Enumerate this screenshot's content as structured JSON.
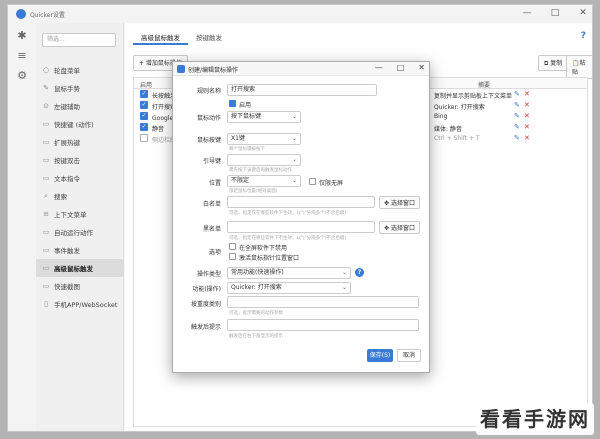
{
  "window": {
    "title": "Quicker设置"
  },
  "sidebar": {
    "search_placeholder": "筛选...",
    "items": [
      {
        "label": "轮盘菜单",
        "icon": "○"
      },
      {
        "label": "鼠标手势",
        "icon": "✎"
      },
      {
        "label": "左键辅助",
        "icon": "⊙"
      },
      {
        "label": "快捷键 (动作)",
        "icon": "▭"
      },
      {
        "label": "扩展热键",
        "icon": "▭"
      },
      {
        "label": "按键双击",
        "icon": "▭"
      },
      {
        "label": "文本指令",
        "icon": "▭"
      },
      {
        "label": "搜索",
        "icon": "⌕"
      },
      {
        "label": "上下文菜单",
        "icon": "≡"
      },
      {
        "label": "自动运行动作",
        "icon": "▭"
      },
      {
        "label": "事件触发",
        "icon": "▭"
      },
      {
        "label": "高级鼠标触发",
        "icon": "▭"
      },
      {
        "label": "快速截图",
        "icon": "▭"
      },
      {
        "label": "手机APP/WebSocket",
        "icon": "▯"
      }
    ]
  },
  "tabs": [
    {
      "label": "高级鼠标触发"
    },
    {
      "label": "按键触发"
    }
  ],
  "toolbar": {
    "add_label": "+ 增加鼠标操作",
    "copy_label": "复制",
    "paste_label": "粘贴",
    "help": "?"
  },
  "table": {
    "col_enabled": "启用",
    "col_summary": "摘要",
    "rows": [
      {
        "name": "长按触发",
        "summary": "复制并显示剪贴板上下文菜单",
        "enabled": true
      },
      {
        "name": "打开搜索",
        "summary": "Quicker: 打开搜索",
        "enabled": true
      },
      {
        "name": "Google搜",
        "summary": "Bing",
        "enabled": true
      },
      {
        "name": "静音",
        "summary": "媒体: 静音",
        "enabled": true
      },
      {
        "name": "侧边栏图",
        "summary": "Ctrl + Shift + T",
        "enabled": false
      }
    ]
  },
  "dialog": {
    "title": "创建/编辑鼠标操作",
    "rule_name_label": "规则名称",
    "rule_name_value": "打开搜索",
    "enabled_label": "启用",
    "mouse_action_label": "鼠标动作",
    "mouse_action_value": "按下鼠标键",
    "mouse_button_label": "鼠标按键",
    "mouse_button_value": "X1键",
    "mouse_button_hint": "哪个鼠标键被按下",
    "trigger_key_label": "引导键",
    "trigger_key_value": "",
    "trigger_key_hint": "需先按下该键后再触发鼠标动作",
    "position_label": "位置",
    "position_value": "不限定",
    "boundary_label": "仅限无屏",
    "position_hint": "限定鼠标位置(相对桌面)",
    "whitelist_label": "白名单",
    "whitelist_hint": "可选，指定仅在哪些软件下生效，以\"|\"分隔多个(不含后缀)",
    "blacklist_label": "黑名单",
    "blacklist_hint": "可选，指定在哪些软件下不生效，以\"|\"分隔多个(不含后缀)",
    "pick_window_label": "选择窗口",
    "options_label": "选项",
    "opt_fullscreen": "在全屏软件下禁用",
    "opt_cursor": "激活鼠标指针位置窗口",
    "op_type_label": "操作类型",
    "op_type_value": "常用功能(快速操作)",
    "function_label": "功能(操作)",
    "function_value": "Quicker: 打开搜索",
    "params_label": "按重度类别",
    "params_hint": "可选，提示需要的动作参数",
    "post_trigger_label": "触发后提示",
    "post_trigger_hint": "触发后在右下角显示的提示",
    "save_label": "保存(S)",
    "cancel_label": "取消"
  },
  "watermark": "看看手游网"
}
